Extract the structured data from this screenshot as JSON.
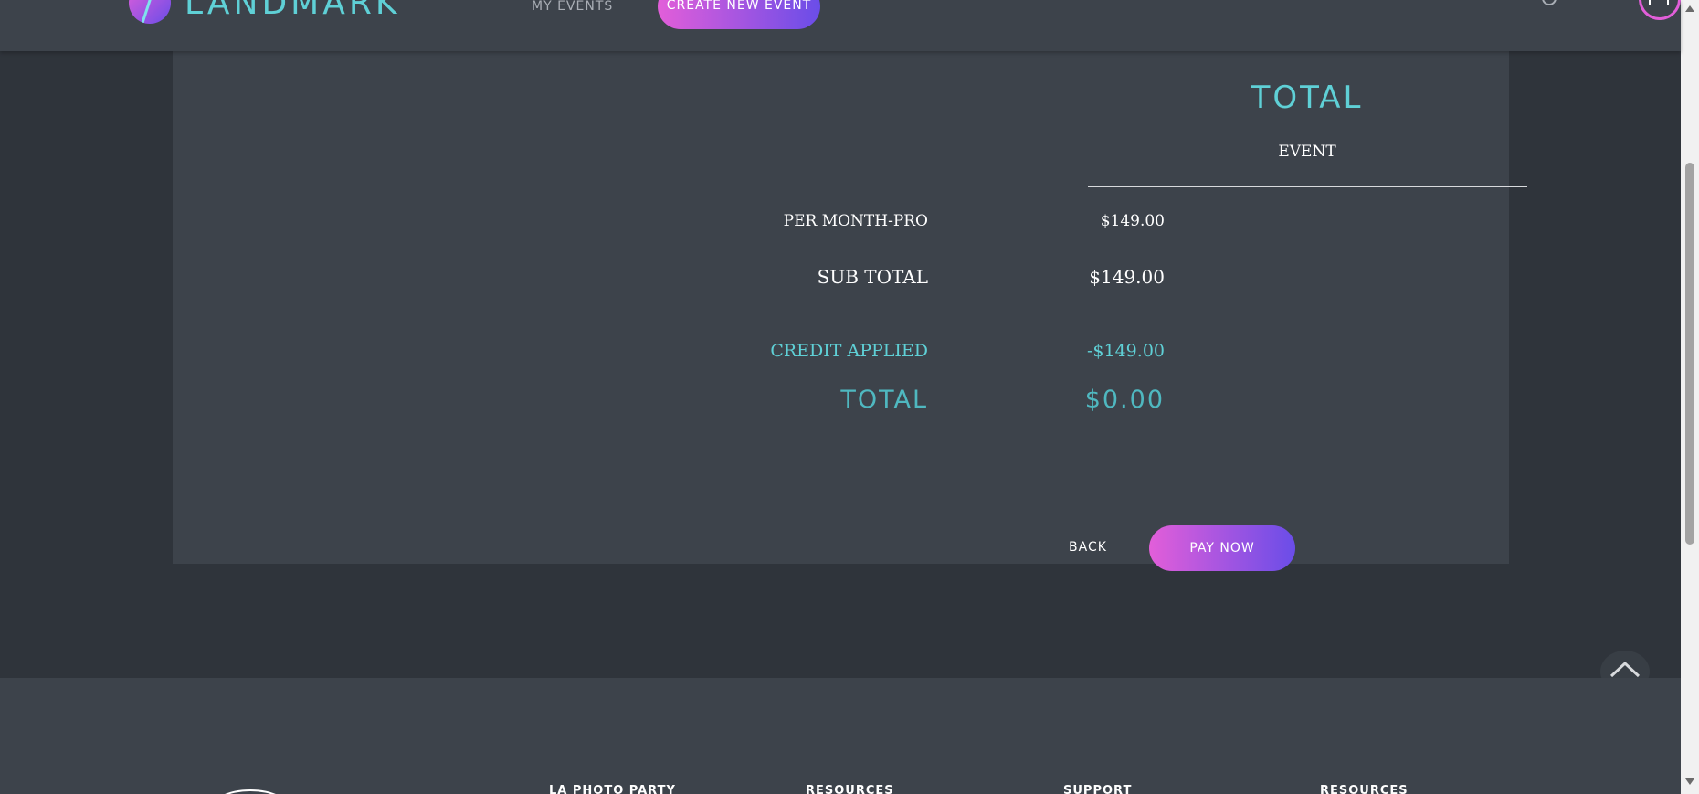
{
  "nav": {
    "brand": "LANDMARK",
    "my_events": "MY EVENTS",
    "create_event": "CREATE NEW EVENT",
    "search_icon": "search-icon",
    "avatar_icon": "user-icon"
  },
  "summary": {
    "title": "TOTAL",
    "subtitle": "EVENT",
    "lines": [
      {
        "label": "PER MONTH-PRO",
        "value": "$149.00"
      },
      {
        "label": "SUB TOTAL",
        "value": "$149.00"
      },
      {
        "label": "CREDIT APPLIED",
        "value": "-$149.00"
      },
      {
        "label": "TOTAL",
        "value": "$0.00"
      }
    ],
    "back_label": "BACK",
    "pay_label": "PAY NOW"
  },
  "footer": {
    "columns": [
      "LA PHOTO PARTY",
      "RESOURCES",
      "SUPPORT",
      "RESOURCES"
    ]
  },
  "colors": {
    "accent": "#5fd0d6",
    "gradient_start": "#e25ed9",
    "gradient_end": "#6a4de8",
    "surface": "#3d434b",
    "background": "#2f343b"
  }
}
